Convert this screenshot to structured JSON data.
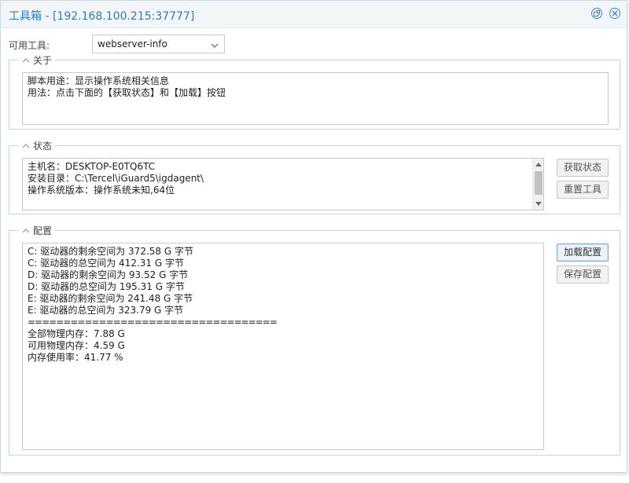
{
  "window": {
    "title": "工具箱 - [192.168.100.215:37777]"
  },
  "tools": {
    "label": "可用工具:",
    "selected": "webserver-info"
  },
  "about": {
    "legend": "关于",
    "lines": [
      "脚本用途：显示操作系统相关信息",
      "用法：点击下面的【获取状态】和【加载】按钮"
    ]
  },
  "status": {
    "legend": "状态",
    "lines": [
      "主机名：DESKTOP-E0TQ6TC",
      "安装目录：C:\\Tercel\\iGuard5\\igdagent\\",
      "操作系统版本：操作系统未知,64位"
    ],
    "get_status_label": "获取状态",
    "reset_tool_label": "重置工具"
  },
  "config": {
    "legend": "配置",
    "lines": [
      "C: 驱动器的剩余空间为 372.58 G 字节",
      "C: 驱动器的总空间为 412.31 G 字节",
      "D: 驱动器的剩余空间为 93.52 G 字节",
      "D: 驱动器的总空间为 195.31 G 字节",
      "E: 驱动器的剩余空间为 241.48 G 字节",
      "E: 驱动器的总空间为 323.79 G 字节",
      "===================================",
      "全部物理内存：7.88 G",
      "可用物理内存：4.59 G",
      "内存使用率：41.77 %"
    ],
    "load_label": "加载配置",
    "save_label": "保存配置"
  },
  "icons": {
    "restore": "restore-icon",
    "close": "close-icon",
    "collapse": "chevron-up-icon",
    "dropdown": "chevron-down-icon"
  },
  "colors": {
    "title": "#2b7cc0",
    "accent_border": "#7aa5d6"
  }
}
